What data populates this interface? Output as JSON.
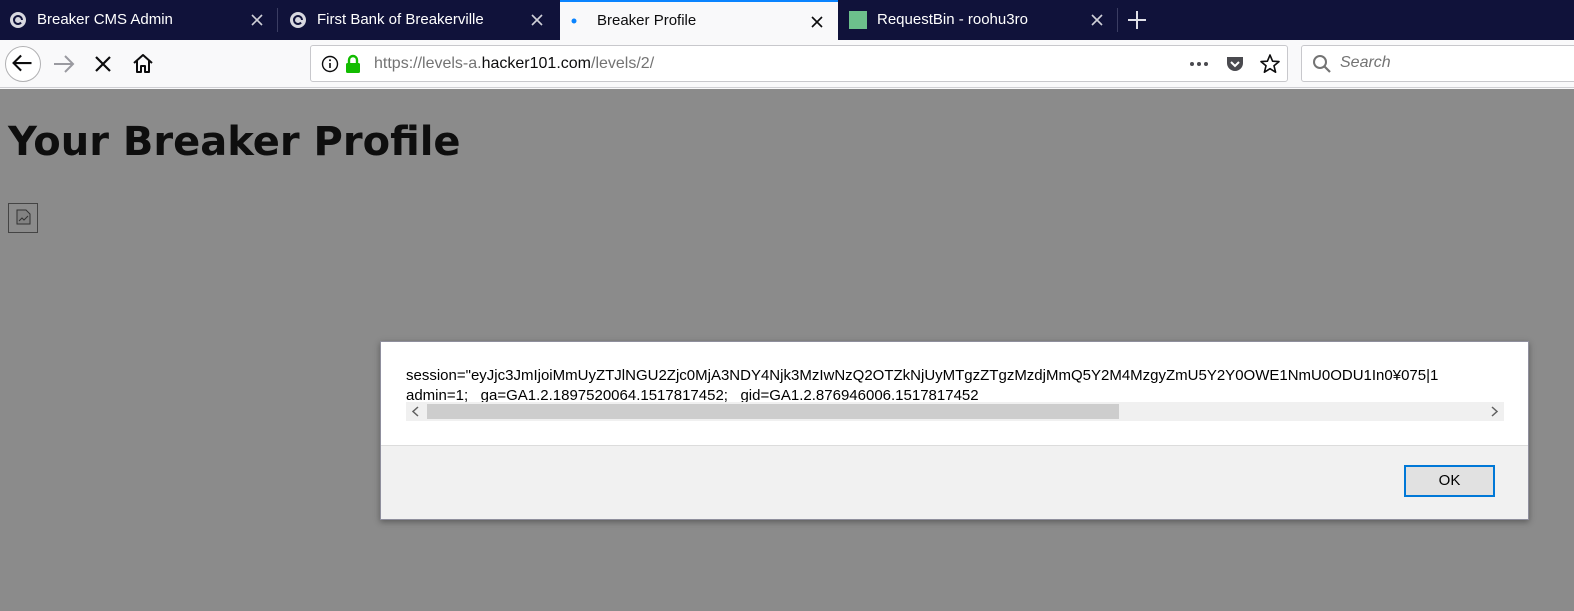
{
  "tabs": [
    {
      "title": "Breaker CMS Admin",
      "favicon": "breaker-logo-icon",
      "active": false
    },
    {
      "title": "First Bank of Breakerville",
      "favicon": "breaker-logo-icon",
      "active": false
    },
    {
      "title": "Breaker Profile",
      "favicon": "loading-dot-icon",
      "active": true
    },
    {
      "title": "RequestBin - roohu3ro",
      "favicon": "requestbin-icon",
      "active": false
    }
  ],
  "url": {
    "prefix": "https://levels-a.",
    "host": "hacker101.com",
    "path": "/levels/2/"
  },
  "search": {
    "placeholder": "Search"
  },
  "page": {
    "title": "Your Breaker Profile"
  },
  "dialog": {
    "line1": "session=\"eyJjc3JmIjoiMmUyZTJlNGU2Zjc0MjA3NDY4Njk3MzIwNzQ2OTZkNjUyMTgzZTgzMzdjMmQ5Y2M4MzgyZmU5Y2Y0OWE1NmU0ODU1In0¥075|1",
    "line2": "admin=1; _ga=GA1.2.1897520064.1517817452; _gid=GA1.2.876946006.1517817452",
    "ok_label": "OK"
  },
  "colors": {
    "tabbar": "#10123a",
    "accent": "#0a84ff",
    "lock": "#12bc00"
  }
}
